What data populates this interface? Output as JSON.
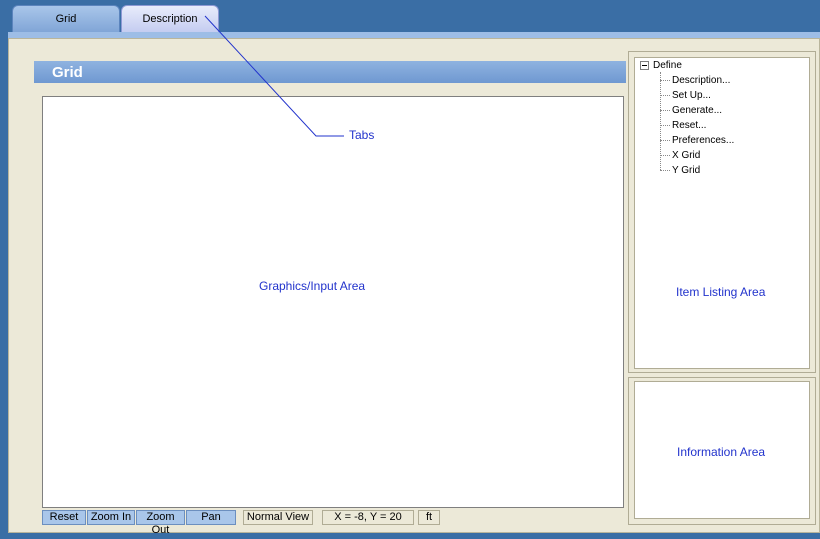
{
  "tabs": [
    {
      "label": "Grid",
      "active": true
    },
    {
      "label": "Description",
      "active": false
    }
  ],
  "header": {
    "title": "Grid"
  },
  "annotations": {
    "tabs": "Tabs",
    "graphics_area": "Graphics/Input Area",
    "item_listing_area": "Item Listing Area",
    "information_area": "Information Area"
  },
  "toolbar": {
    "reset": "Reset",
    "zoom_in": "Zoom In",
    "zoom_out": "Zoom Out",
    "pan": "Pan",
    "view_mode": "Normal View",
    "coordinates": "X = -8, Y = 20",
    "units": "ft"
  },
  "tree": {
    "root": "Define",
    "items": [
      "Description...",
      "Set Up...",
      "Generate...",
      "Reset...",
      "Preferences...",
      "X Grid",
      "Y Grid"
    ]
  },
  "colors": {
    "window_bg": "#3a6ea5",
    "panel_bg": "#ece9d8",
    "header_bg": "#7fa4d6",
    "annotation_text": "#2233cc"
  }
}
